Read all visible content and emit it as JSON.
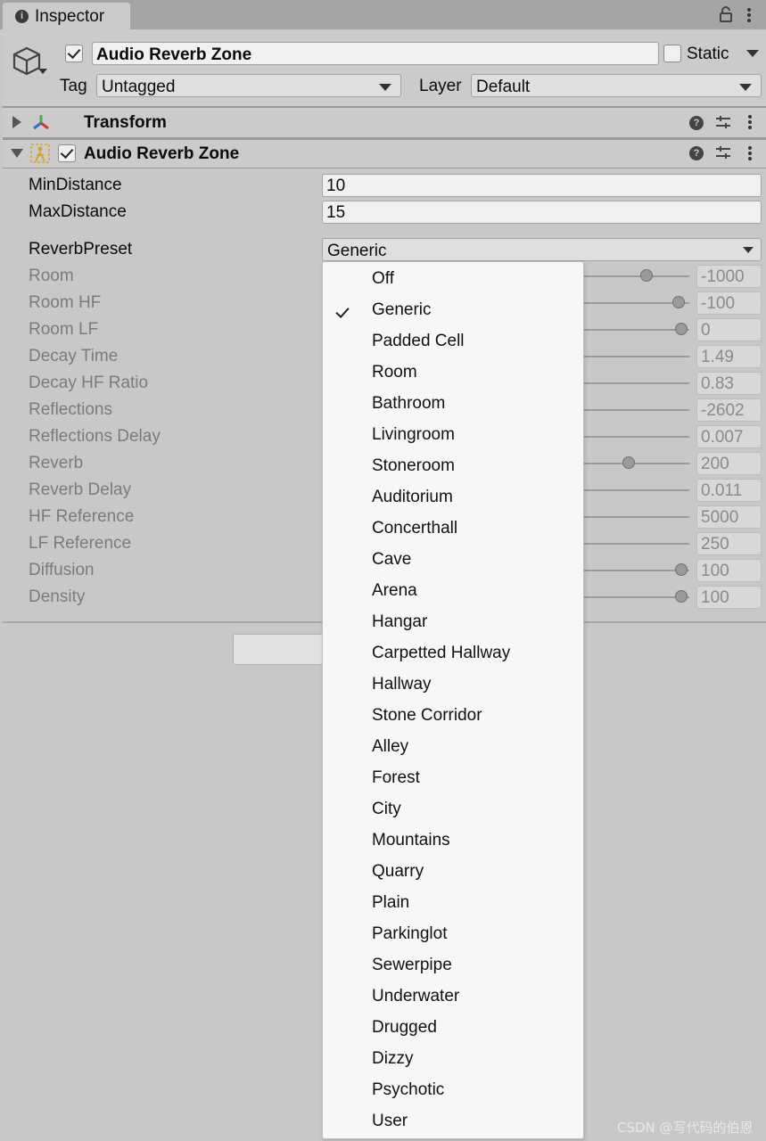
{
  "window": {
    "tab_title": "Inspector",
    "tab_icon": "info-icon"
  },
  "header": {
    "object_name": "Audio Reverb Zone",
    "active_checked": true,
    "static_label": "Static",
    "static_checked": false,
    "tag_label": "Tag",
    "tag_value": "Untagged",
    "layer_label": "Layer",
    "layer_value": "Default"
  },
  "components": {
    "transform": {
      "title": "Transform",
      "expanded": false
    },
    "reverb_zone": {
      "title": "Audio Reverb Zone",
      "expanded": true,
      "enabled": true
    }
  },
  "properties": {
    "min_distance": {
      "label": "MinDistance",
      "value": "10"
    },
    "max_distance": {
      "label": "MaxDistance",
      "value": "15"
    },
    "reverb_preset": {
      "label": "ReverbPreset",
      "value": "Generic"
    },
    "room": {
      "label": "Room",
      "value": "-1000"
    },
    "room_hf": {
      "label": "Room HF",
      "value": "-100"
    },
    "room_lf": {
      "label": "Room LF",
      "value": "0"
    },
    "decay_time": {
      "label": "Decay Time",
      "value": "1.49"
    },
    "decay_hf_ratio": {
      "label": "Decay HF Ratio",
      "value": "0.83"
    },
    "reflections": {
      "label": "Reflections",
      "value": "-2602"
    },
    "reflections_delay": {
      "label": "Reflections Delay",
      "value": "0.007"
    },
    "reverb": {
      "label": "Reverb",
      "value": "200"
    },
    "reverb_delay": {
      "label": "Reverb Delay",
      "value": "0.011"
    },
    "hf_reference": {
      "label": "HF Reference",
      "value": "5000"
    },
    "lf_reference": {
      "label": "LF Reference",
      "value": "250"
    },
    "diffusion": {
      "label": "Diffusion",
      "value": "100"
    },
    "density": {
      "label": "Density",
      "value": "100"
    }
  },
  "preset_menu": {
    "selected": "Generic",
    "items": [
      "Off",
      "Generic",
      "Padded Cell",
      "Room",
      "Bathroom",
      "Livingroom",
      "Stoneroom",
      "Auditorium",
      "Concerthall",
      "Cave",
      "Arena",
      "Hangar",
      "Carpetted Hallway",
      "Hallway",
      "Stone Corridor",
      "Alley",
      "Forest",
      "City",
      "Mountains",
      "Quarry",
      "Plain",
      "Parkinglot",
      "Sewerpipe",
      "Underwater",
      "Drugged",
      "Dizzy",
      "Psychotic",
      "User"
    ]
  },
  "watermark": "CSDN @写代码的伯恩"
}
